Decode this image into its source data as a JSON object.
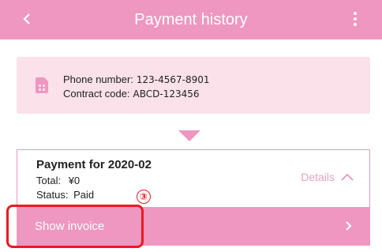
{
  "header": {
    "title": "Payment history",
    "back_icon": "chevron-left-icon",
    "menu_icon": "more-vert-icon",
    "color": "#ee97c0"
  },
  "account": {
    "icon": "sim-card-icon",
    "phone_label": "Phone number:",
    "phone_value": "123-4567-8901",
    "contract_label": "Contract code:",
    "contract_value": "ABCD-123456"
  },
  "payment": {
    "title": "Payment for 2020-02",
    "total_label": "Total:",
    "total_value": "¥0",
    "status_label": "Status:",
    "status_value": "Paid",
    "details_label": "Details",
    "details_icon": "chevron-up-icon"
  },
  "invoice": {
    "label": "Show invoice",
    "icon": "chevron-right-icon"
  },
  "annotation": {
    "step": "③",
    "color": "#e81b22"
  }
}
